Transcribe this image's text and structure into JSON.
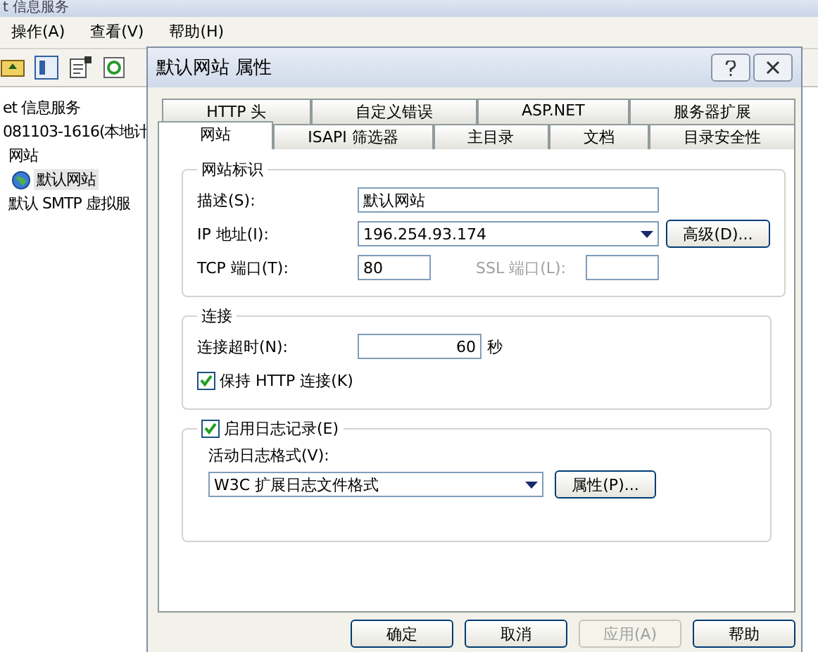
{
  "main_window": {
    "title": "t 信息服务",
    "menu": [
      "操作(A)",
      "查看(V)",
      "帮助(H)"
    ],
    "tree": [
      {
        "label": "et 信息服务",
        "selected": false,
        "children": [
          {
            "label": "081103-1616(本地计",
            "selected": false,
            "children": [
              {
                "label": "网站",
                "selected": false,
                "children": [
                  {
                    "label": "默认网站",
                    "selected": true
                  }
                ]
              },
              {
                "label": "默认 SMTP 虚拟服",
                "selected": false
              }
            ]
          }
        ]
      }
    ]
  },
  "dialog": {
    "title": "默认网站 属性",
    "tab_rows": [
      [
        {
          "label": "HTTP 头",
          "selected": false
        },
        {
          "label": "自定义错误",
          "selected": false
        },
        {
          "label": "ASP.NET",
          "selected": false
        },
        {
          "label": "服务器扩展",
          "selected": false
        }
      ],
      [
        {
          "label": "网站",
          "selected": true
        },
        {
          "label": "ISAPI 筛选器",
          "selected": false
        },
        {
          "label": "主目录",
          "selected": false
        },
        {
          "label": "文档",
          "selected": false
        },
        {
          "label": "目录安全性",
          "selected": false
        }
      ]
    ],
    "identity": {
      "title": "网站标识",
      "description_label": "描述(S):",
      "description": "默认网站",
      "ip_label": "IP 地址(I):",
      "ip": "196.254.93.174",
      "advanced_button": "高级(D)...",
      "tcp_label": "TCP 端口(T):",
      "tcp_port": "80",
      "ssl_label": "SSL 端口(L):",
      "ssl_disabled": true
    },
    "connection": {
      "title": "连接",
      "timeout_label": "连接超时(N):",
      "timeout": "60",
      "unit": "秒",
      "keep_alive": {
        "label": "保持 HTTP 连接(K)",
        "checked": true
      }
    },
    "logging": {
      "enable": {
        "label": "启用日志记录(E)",
        "checked": true
      },
      "format_label": "活动日志格式(V):",
      "format": "W3C 扩展日志文件格式",
      "properties_button": "属性(P)..."
    },
    "buttons": [
      {
        "label": "确定",
        "disabled": false
      },
      {
        "label": "取消",
        "disabled": false
      },
      {
        "label": "应用(A)",
        "disabled": true
      },
      {
        "label": "帮助",
        "disabled": false
      }
    ]
  }
}
